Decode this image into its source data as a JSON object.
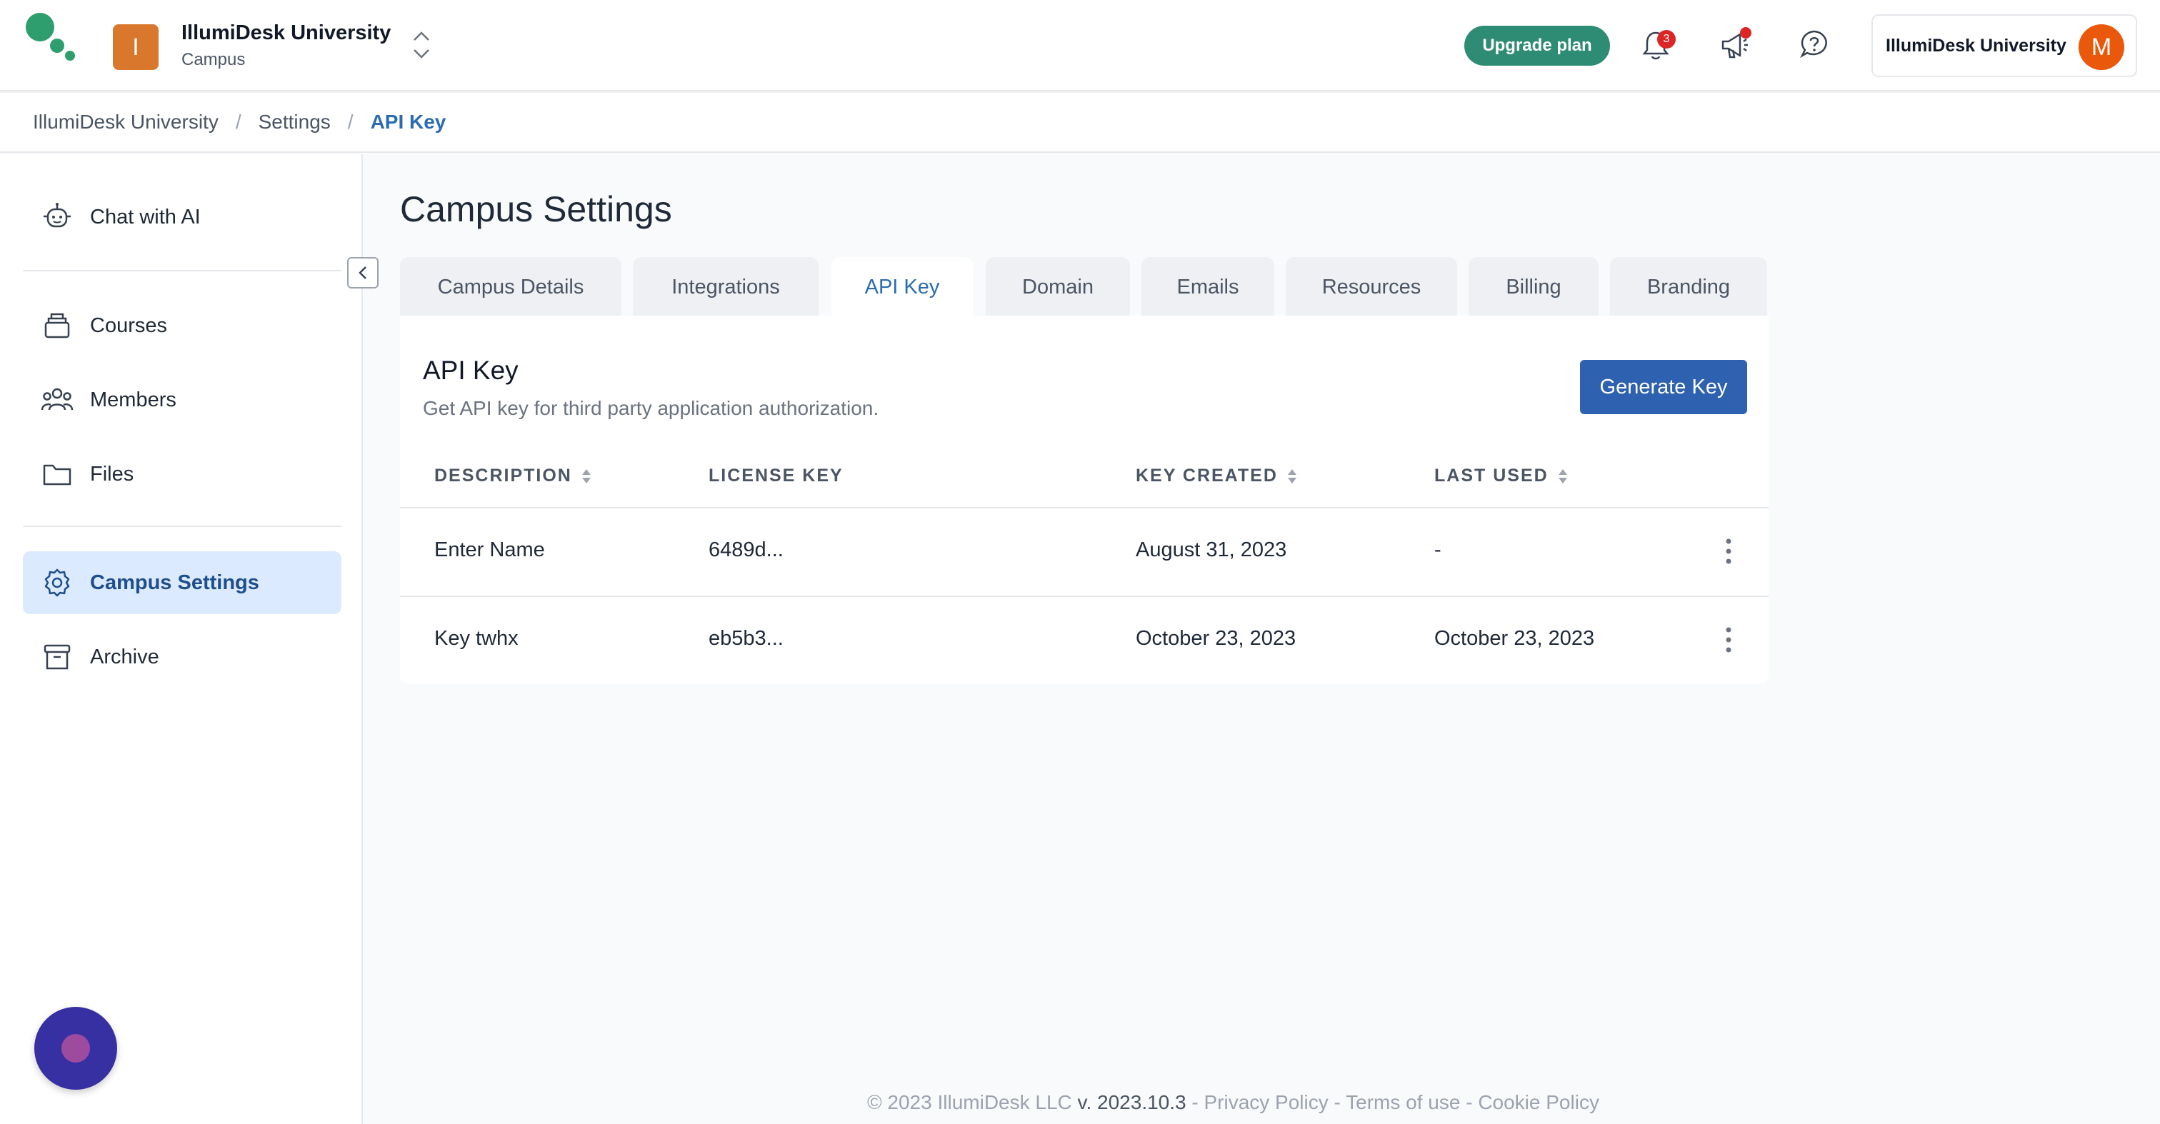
{
  "header": {
    "org_initial": "I",
    "org_name": "IllumiDesk University",
    "org_sub": "Campus",
    "upgrade_label": "Upgrade plan",
    "notification_count": "3",
    "user_name": "IllumiDesk University",
    "user_initial": "M",
    "icons": [
      "logo-icon",
      "chevron-updown-icon",
      "bell-icon",
      "megaphone-icon",
      "help-icon"
    ]
  },
  "breadcrumb": {
    "items": [
      "IllumiDesk University",
      "Settings",
      "API Key"
    ],
    "separator": "/"
  },
  "sidebar": {
    "chat": "Chat with AI",
    "items": [
      {
        "label": "Courses",
        "icon": "courses-icon"
      },
      {
        "label": "Members",
        "icon": "members-icon"
      },
      {
        "label": "Files",
        "icon": "folder-icon"
      },
      {
        "label": "Campus Settings",
        "icon": "gear-icon",
        "active": true
      },
      {
        "label": "Archive",
        "icon": "archive-icon"
      }
    ]
  },
  "main": {
    "title": "Campus Settings",
    "tabs": [
      "Campus Details",
      "Integrations",
      "API Key",
      "Domain",
      "Emails",
      "Resources",
      "Billing",
      "Branding"
    ],
    "active_tab": "API Key",
    "card": {
      "title": "API Key",
      "subtitle": "Get API key for third party application authorization.",
      "generate_label": "Generate Key"
    },
    "table": {
      "columns": [
        "DESCRIPTION",
        "LICENSE KEY",
        "KEY CREATED",
        "LAST USED"
      ],
      "rows": [
        {
          "description": "Enter Name",
          "license": "6489d...",
          "created": "August 31, 2023",
          "last_used": "-"
        },
        {
          "description": "Key twhx",
          "license": "eb5b3...",
          "created": "October 23, 2023",
          "last_used": "October 23, 2023"
        }
      ]
    }
  },
  "footer": {
    "copyright": "© 2023 IllumiDesk LLC",
    "version": "v. 2023.10.3",
    "sep": " - ",
    "privacy": "Privacy Policy",
    "terms": "Terms of use",
    "cookie": "Cookie Policy"
  },
  "colors": {
    "accent": "#2b6cb0",
    "upgrade": "#2f8c74",
    "org_avatar": "#d9772c",
    "user_avatar": "#ea580c",
    "chat_bubble": "#3730a3"
  }
}
